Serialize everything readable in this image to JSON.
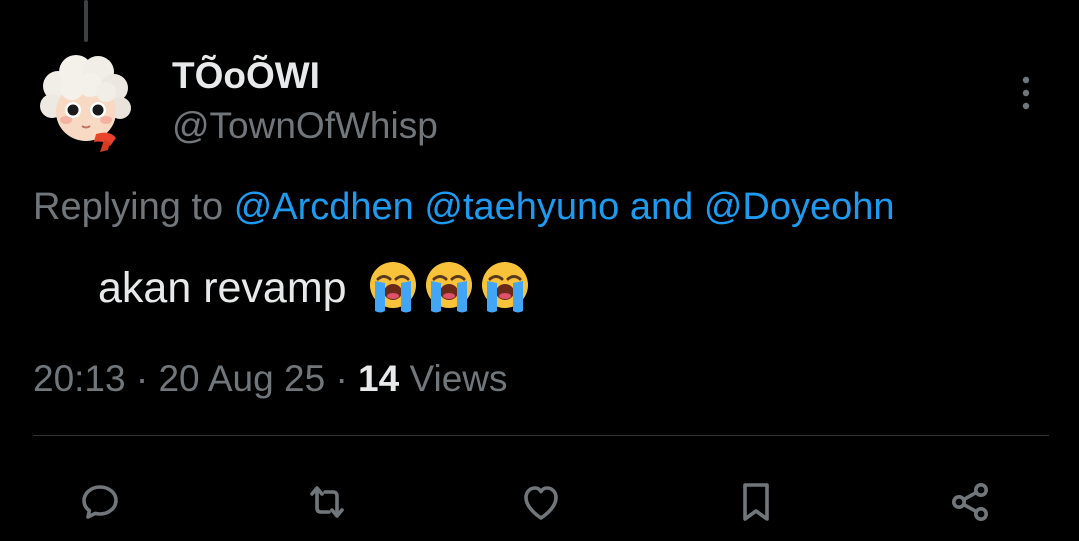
{
  "tweet": {
    "author": {
      "display_name": "TÕoÕWI",
      "handle": "@TownOfWhisp"
    },
    "replying_to": {
      "prefix": "Replying to",
      "mention_1": "@Arcdhen",
      "mention_2": "@taehyuno",
      "conjunction": "and",
      "mention_3": "@Doyeohn"
    },
    "text": "akan revamp",
    "emojis": [
      "loudly-crying-face",
      "loudly-crying-face",
      "loudly-crying-face"
    ],
    "meta": {
      "time": "20:13",
      "separator": "·",
      "date": "20 Aug 25",
      "views_count": "14",
      "views_label": "Views"
    }
  },
  "actions": [
    "reply-icon",
    "retweet-icon",
    "like-icon",
    "bookmark-icon",
    "share-icon"
  ],
  "colors": {
    "background": "#000000",
    "primary_text": "#e7e9ea",
    "secondary_text": "#71767b",
    "link": "#1d9bf0",
    "divider": "#2f3336"
  }
}
